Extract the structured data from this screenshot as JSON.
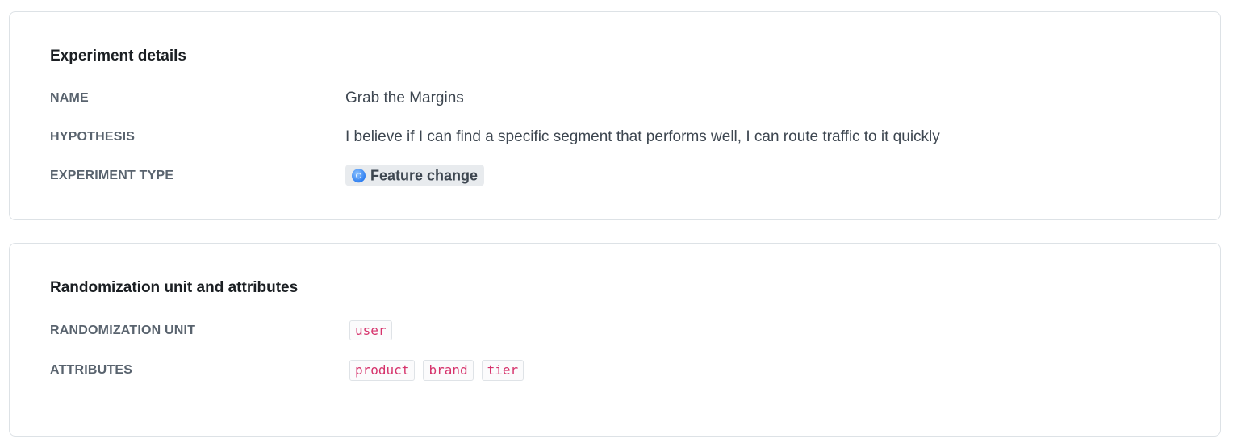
{
  "experiment_details": {
    "title": "Experiment details",
    "name_label": "NAME",
    "name_value": "Grab the Margins",
    "hypothesis_label": "HYPOTHESIS",
    "hypothesis_value": "I believe if I can find a specific segment that performs well, I can route traffic to it quickly",
    "type_label": "EXPERIMENT TYPE",
    "type_value": "Feature change",
    "type_icon": "feature-change-icon"
  },
  "randomization": {
    "title": "Randomization unit and attributes",
    "unit_label": "RANDOMIZATION UNIT",
    "unit_value": "user",
    "attributes_label": "ATTRIBUTES",
    "attributes": [
      "product",
      "brand",
      "tier"
    ]
  },
  "colors": {
    "chip_text": "#d6336c",
    "pill_bg": "#e8ebee",
    "icon_blue": "#2f7ff0"
  }
}
